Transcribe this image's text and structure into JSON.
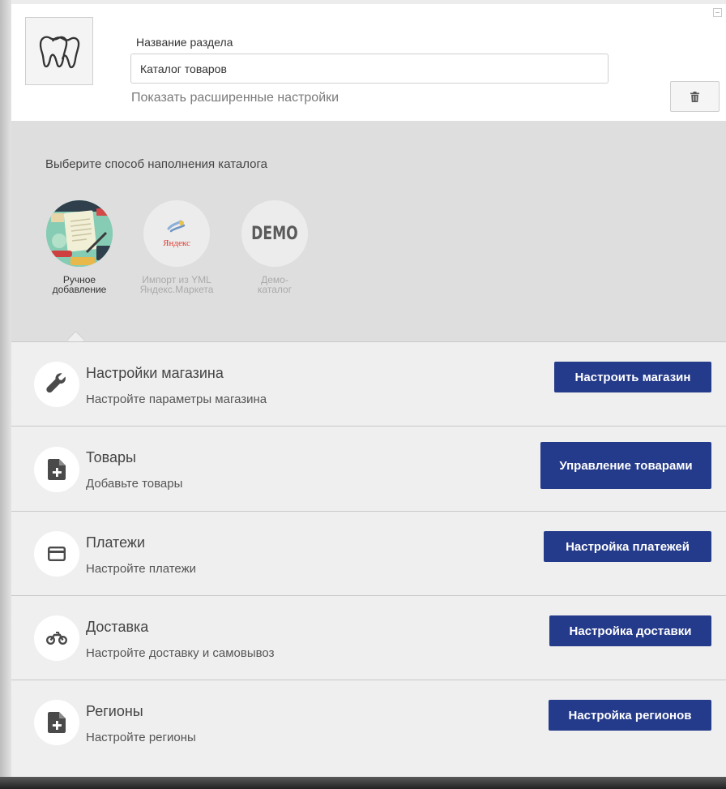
{
  "header": {
    "field_label": "Название раздела",
    "name_value": "Каталог товаров",
    "advanced_link": "Показать расширенные настройки",
    "section_icon": "tooth-icon",
    "delete_icon": "trash-icon"
  },
  "fill": {
    "title": "Выберите способ наполнения каталога",
    "methods": [
      {
        "label": "Ручное добавление",
        "active": true,
        "icon": "manual-illustration"
      },
      {
        "label": "Импорт из YML Яндекс.Маркета",
        "active": false,
        "logo_text": "Яндекс"
      },
      {
        "label": "Демо-каталог",
        "active": false,
        "logo_text": "DEMO"
      }
    ]
  },
  "rows": [
    {
      "title": "Настройки магазина",
      "subtitle": "Настройте параметры магазина",
      "button": "Настроить магазин",
      "icon": "wrench-icon"
    },
    {
      "title": "Товары",
      "subtitle": "Добавьте товары",
      "button": "Управление товарами",
      "icon": "file-plus-icon"
    },
    {
      "title": "Платежи",
      "subtitle": "Настройте платежи",
      "button": "Настройка платежей",
      "icon": "credit-card-icon"
    },
    {
      "title": "Доставка",
      "subtitle": "Настройте доставку и самовывоз",
      "button": "Настройка доставки",
      "icon": "motorcycle-icon"
    },
    {
      "title": "Регионы",
      "subtitle": "Настройте регионы",
      "button": "Настройка регионов",
      "icon": "file-plus-icon"
    }
  ],
  "colors": {
    "button_bg": "#243a8a",
    "panel_bg": "#efefef",
    "fill_section_bg": "#dedede"
  }
}
